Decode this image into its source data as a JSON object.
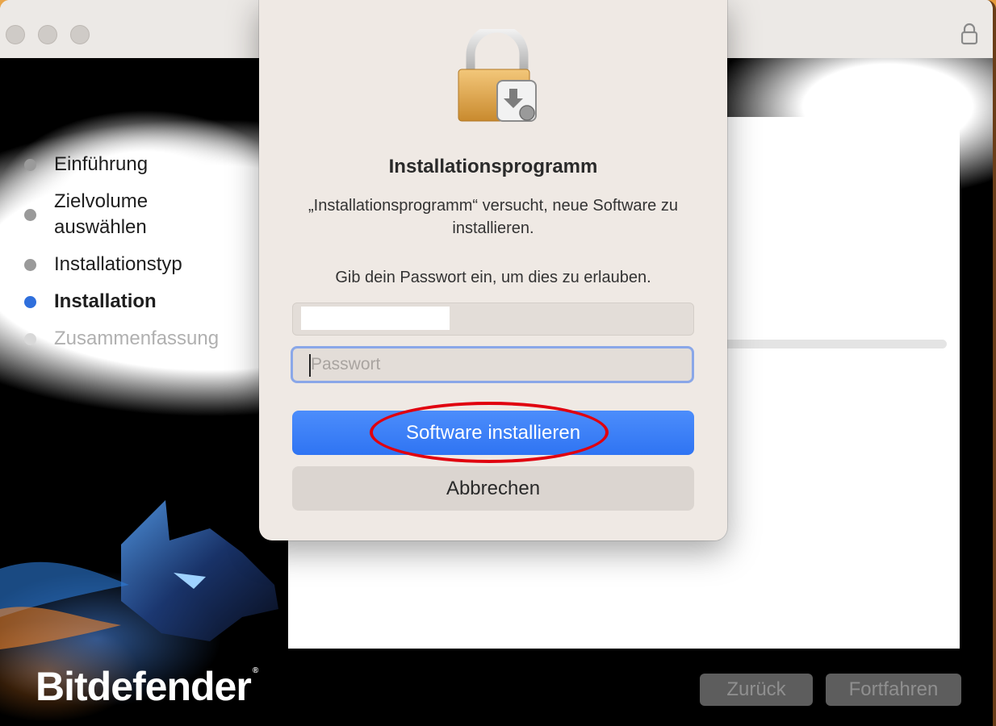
{
  "installer": {
    "steps": [
      {
        "label": "Einführung",
        "state": "done"
      },
      {
        "label": "Zielvolume\nauswählen",
        "state": "done"
      },
      {
        "label": "Installationstyp",
        "state": "done"
      },
      {
        "label": "Installation",
        "state": "active"
      },
      {
        "label": "Zusammenfassung",
        "state": "future"
      }
    ],
    "brand": "Bitdefender",
    "brand_mark": "®",
    "back_label": "Zurück",
    "continue_label": "Fortfahren"
  },
  "dialog": {
    "title": "Installationsprogramm",
    "message": "„Installationsprogramm“ versucht, neue Software zu installieren.",
    "prompt": "Gib dein Passwort ein, um dies zu erlauben.",
    "password_placeholder": "Passwort",
    "confirm_label": "Software installieren",
    "cancel_label": "Abbrechen"
  },
  "colors": {
    "accent": "#2f74f3",
    "highlight": "#e0000f",
    "active_step": "#2f6fdc"
  }
}
